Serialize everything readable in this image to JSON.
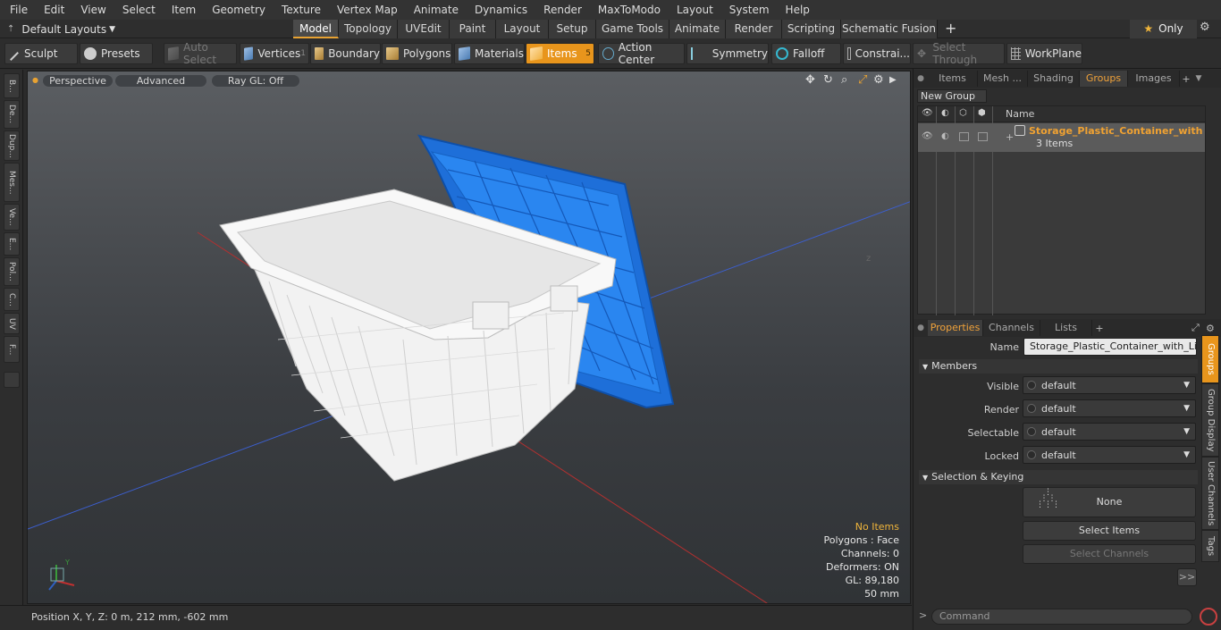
{
  "menubar": [
    "File",
    "Edit",
    "View",
    "Select",
    "Item",
    "Geometry",
    "Texture",
    "Vertex Map",
    "Animate",
    "Dynamics",
    "Render",
    "MaxToModo",
    "Layout",
    "System",
    "Help"
  ],
  "modebar": {
    "layouts_label": "Default Layouts",
    "tabs": [
      "Model",
      "Topology",
      "UVEdit",
      "Paint",
      "Layout",
      "Setup",
      "Game Tools",
      "Animate",
      "Render",
      "Scripting",
      "Schematic Fusion"
    ],
    "active_tab": "Model",
    "only_label": "Only"
  },
  "toolbar": {
    "sculpt": "Sculpt",
    "presets": "Presets",
    "auto_select": "Auto Select",
    "vertices": "Vertices",
    "vertices_count": "1",
    "boundary": "Boundary",
    "polygons": "Polygons",
    "materials": "Materials",
    "items": "Items",
    "items_count": "5",
    "action_center": "Action Center",
    "symmetry": "Symmetry",
    "falloff": "Falloff",
    "constraints": "Constrai...",
    "select_through": "Select Through",
    "workplane": "WorkPlane"
  },
  "left_tabs": [
    "B...",
    "De...",
    "Dup...",
    "Mes...",
    "Ve...",
    "E...",
    "Pol...",
    "C...",
    "UV",
    "F..."
  ],
  "viewport": {
    "perspective": "Perspective",
    "advanced": "Advanced",
    "raygl": "Ray GL: Off",
    "stats": {
      "items": "No Items",
      "polygons": "Polygons : Face",
      "channels": "Channels: 0",
      "deformers": "Deformers: ON",
      "gl": "GL: 89,180",
      "scale": "50 mm"
    },
    "axis_z": "z"
  },
  "statusbar": {
    "position": "Position X, Y, Z:   0 m, 212 mm, -602 mm"
  },
  "right_tabs": [
    "Items",
    "Mesh ...",
    "Shading",
    "Groups",
    "Images"
  ],
  "right_active_tab": "Groups",
  "groups": {
    "new_group": "New Group",
    "name_col": "Name",
    "row_name": "Storage_Plastic_Container_with...",
    "row_sub": "3 Items"
  },
  "properties": {
    "tabs": [
      "Properties",
      "Channels",
      "Lists"
    ],
    "name_label": "Name",
    "name_value": "Storage_Plastic_Container_with_Lid (",
    "members": "Members",
    "visible_label": "Visible",
    "visible_value": "default",
    "render_label": "Render",
    "render_value": "default",
    "selectable_label": "Selectable",
    "selectable_value": "default",
    "locked_label": "Locked",
    "locked_value": "default",
    "selection_keying": "Selection & Keying",
    "none_label": "None",
    "select_items": "Select Items",
    "select_channels": "Select Channels",
    "more": ">>"
  },
  "side_tabs": [
    "Groups",
    "Group Display",
    "User Channels",
    "Tags"
  ],
  "command_placeholder": "Command"
}
